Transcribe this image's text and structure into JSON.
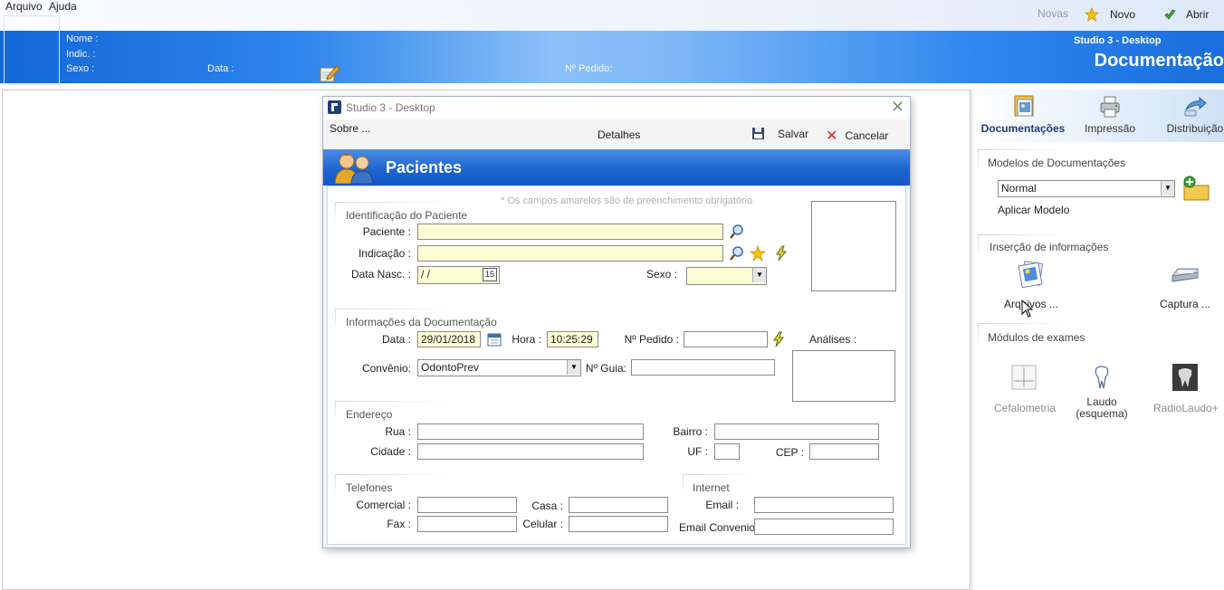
{
  "menubar": {
    "items": [
      "Arquivo",
      "Ajuda"
    ]
  },
  "toolbar": {
    "news_label": "Novas",
    "new_label": "Novo",
    "open_label": "Abrir"
  },
  "header": {
    "subtitle": "Studio 3 - Desktop",
    "title": "Documentação",
    "name_label": "Nome :",
    "indic_label": "Indic. :",
    "sex_label": "Sexo :",
    "date_label": "Data :",
    "order_label": "Nº Pedido:"
  },
  "right_panel": {
    "tabs": [
      {
        "label": "Documentações",
        "icon": "documents-icon",
        "active": true
      },
      {
        "label": "Impressão",
        "icon": "printer-icon"
      },
      {
        "label": "Distribuição",
        "icon": "distribution-icon"
      }
    ],
    "models_group": {
      "title": "Modelos de Documentações",
      "select_value": "Normal",
      "apply_label": "Aplicar Modelo"
    },
    "insert_group": {
      "title": "Inserção de informações",
      "files_label": "Arquivos ...",
      "capture_label": "Captura ..."
    },
    "exams_group": {
      "title": "Módulos de exames",
      "items": [
        "Cefalometria",
        "Laudo\n(esquema)",
        "RadioLaudo+"
      ]
    }
  },
  "dialog": {
    "title": "Studio 3 - Desktop",
    "about_label": "Sobre ...",
    "details_label": "Detalhes",
    "save_label": "Salvar",
    "cancel_label": "Cancelar",
    "banner_title": "Pacientes",
    "required_note": "* Os campos amarelos são de preenchimento obrigatório",
    "identification": {
      "title": "Identificação do Paciente",
      "patient_label": "Paciente :",
      "patient_value": "",
      "indication_label": "Indicação :",
      "indication_value": "",
      "birth_label": "Data Nasc. :",
      "birth_value": " /  /",
      "calendar_day": "15",
      "sex_label": "Sexo :",
      "sex_value": ""
    },
    "documentation": {
      "title": "Informações da Documentação",
      "date_label": "Data :",
      "date_value": "29/01/2018",
      "time_label": "Hora :",
      "time_value": "10:25:29",
      "order_label": "Nº Pedido :",
      "order_value": "",
      "analyses_label": "Análises :",
      "insurance_label": "Convênio:",
      "insurance_value": "OdontoPrev",
      "guide_label": "Nº Guia:",
      "guide_value": ""
    },
    "address": {
      "title": "Endereço",
      "street_label": "Rua :",
      "district_label": "Bairro :",
      "city_label": "Cidade :",
      "state_label": "UF :",
      "zip_label": "CEP :"
    },
    "phones": {
      "title": "Telefones",
      "commercial_label": "Comercial :",
      "home_label": "Casa :",
      "fax_label": "Fax :",
      "mobile_label": "Celular :"
    },
    "internet": {
      "title": "Internet",
      "email_label": "Email :",
      "email_insurance_label": "Email Convenio"
    }
  },
  "colors": {
    "header_blue": "#1a6edd",
    "banner_blue": "#1d64cf",
    "required_yellow": "#ffffd6"
  }
}
